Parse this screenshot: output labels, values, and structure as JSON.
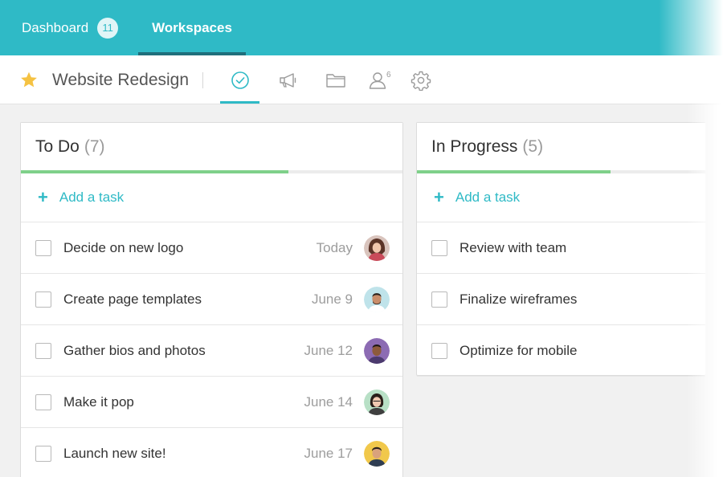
{
  "nav": {
    "tabs": [
      {
        "label": "Dashboard",
        "badge": "11"
      },
      {
        "label": "Workspaces"
      }
    ]
  },
  "project": {
    "title": "Website Redesign",
    "people_count": "6"
  },
  "colors": {
    "accent": "#2fbac6",
    "progress": "#7fd08a",
    "star": "#f5c242"
  },
  "columns": [
    {
      "title": "To Do",
      "count": "(7)",
      "progress": 0.7,
      "add_label": "Add a task",
      "tasks": [
        {
          "name": "Decide on new logo",
          "date": "Today"
        },
        {
          "name": "Create page templates",
          "date": "June 9"
        },
        {
          "name": "Gather bios and photos",
          "date": "June 12"
        },
        {
          "name": "Make it pop",
          "date": "June 14"
        },
        {
          "name": "Launch new site!",
          "date": "June 17"
        }
      ]
    },
    {
      "title": "In Progress",
      "count": "(5)",
      "progress": 0.67,
      "add_label": "Add a task",
      "tasks": [
        {
          "name": "Review with team"
        },
        {
          "name": "Finalize wireframes"
        },
        {
          "name": "Optimize for mobile"
        }
      ]
    }
  ]
}
